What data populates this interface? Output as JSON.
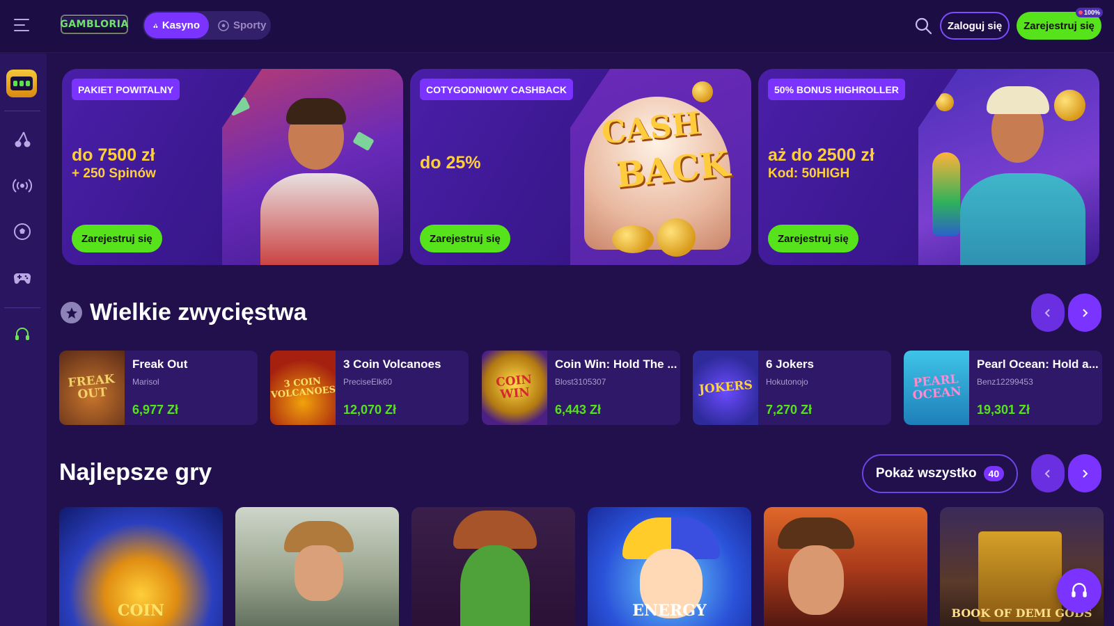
{
  "header": {
    "logo_text": "GAMBLORIA",
    "tabs": [
      {
        "label": "Kasyno",
        "icon": "cherry-icon",
        "active": true
      },
      {
        "label": "Sporty",
        "icon": "soccer-ball-icon",
        "active": false
      }
    ],
    "login_label": "Zaloguj się",
    "register_label": "Zarejestruj się",
    "register_badge": "100%"
  },
  "sidebar": {
    "items": [
      {
        "name": "slot-machine-icon"
      },
      {
        "name": "cherry-icon"
      },
      {
        "name": "live-broadcast-icon"
      },
      {
        "name": "soccer-ball-icon"
      },
      {
        "name": "gamepad-icon"
      },
      {
        "name": "headset-icon"
      }
    ]
  },
  "banners": [
    {
      "tag": "PAKIET POWITALNY",
      "headline": "do 7500 zł",
      "subline": "+ 250 Spinów",
      "cta": "Zarejestruj się"
    },
    {
      "tag": "COTYGODNIOWY CASHBACK",
      "headline": "do 25%",
      "subline": "",
      "cta": "Zarejestruj się",
      "art_text_1": "CASH",
      "art_text_2": "BACK"
    },
    {
      "tag": "50% BONUS HIGHROLLER",
      "headline": "aż do 2500 zł",
      "subline": "Kod: 50HIGH",
      "cta": "Zarejestruj się"
    }
  ],
  "big_wins": {
    "title": "Wielkie zwycięstwa",
    "items": [
      {
        "game": "Freak Out",
        "user": "Marisol",
        "amount": "6,977 Zł",
        "thumb_text": "FREAK OUT"
      },
      {
        "game": "3 Coin Volcanoes",
        "user": "PreciseElk60",
        "amount": "12,070 Zł",
        "thumb_text": "3 COIN VOLCANOES"
      },
      {
        "game": "Coin Win: Hold The ...",
        "user": "Blost3105307",
        "amount": "6,443 Zł",
        "thumb_text": "COIN WIN"
      },
      {
        "game": "6 Jokers",
        "user": "Hokutonojo",
        "amount": "7,270 Zł",
        "thumb_text": "JOKERS"
      },
      {
        "game": "Pearl Ocean: Hold a...",
        "user": "Benz12299453",
        "amount": "19,301 Zł",
        "thumb_text": "PEARL OCEAN"
      }
    ]
  },
  "top_games": {
    "title": "Najlepsze gry",
    "show_all_label": "Pokaż wszystko",
    "show_all_count": "40",
    "tiles": [
      {
        "label": "COIN"
      },
      {
        "label": ""
      },
      {
        "label": ""
      },
      {
        "label": "ENERGY"
      },
      {
        "label": ""
      },
      {
        "label": "BOOK OF DEMI GODS"
      }
    ]
  },
  "colors": {
    "background": "#22104d",
    "accent": "#7b33ff",
    "cta_green": "#57e31b",
    "gold": "#ffcf3a"
  }
}
